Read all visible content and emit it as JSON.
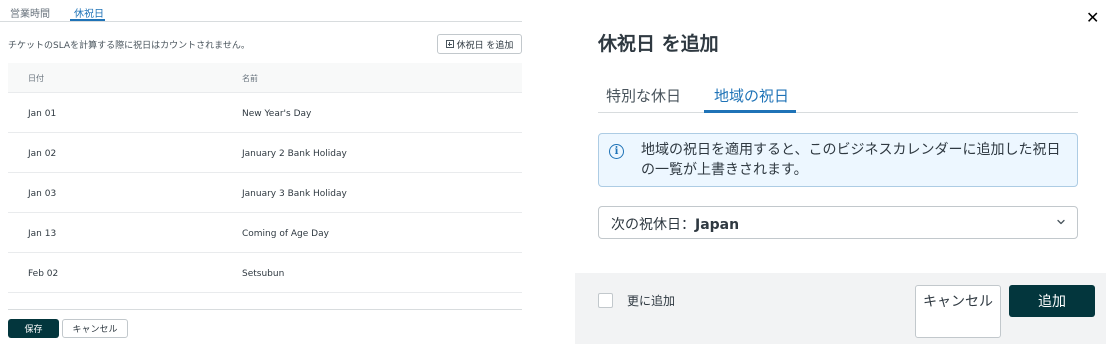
{
  "settings": {
    "tabs": [
      {
        "label": "営業時間"
      },
      {
        "label": "休祝日"
      }
    ],
    "note": "チケットのSLAを計算する際に祝日はカウントされません。",
    "add_holiday_label": "休祝日 を追加",
    "table": {
      "headers": {
        "date": "日付",
        "name": "名前"
      },
      "rows": [
        {
          "date": "Jan 01",
          "name": "New Year's Day"
        },
        {
          "date": "Jan 02",
          "name": "January 2 Bank Holiday"
        },
        {
          "date": "Jan 03",
          "name": "January 3 Bank Holiday"
        },
        {
          "date": "Jan 13",
          "name": "Coming of Age Day"
        },
        {
          "date": "Feb 02",
          "name": "Setsubun"
        }
      ]
    },
    "save_label": "保存",
    "cancel_label": "キャンセル"
  },
  "modal": {
    "close_glyph": "✕",
    "title": "休祝日 を追加",
    "tabs": [
      {
        "label": "特別な休日"
      },
      {
        "label": "地域の祝日"
      }
    ],
    "info_icon_glyph": "i",
    "info_text": "地域の祝日を適用すると、このビジネスカレンダーに追加した祝日の一覧が上書きされます。",
    "select": {
      "prefix": "次の祝休日：",
      "value": "Japan"
    },
    "checkbox_label": "更に追加",
    "cancel_label": "キャンセル",
    "add_label": "追加"
  },
  "colors": {
    "primary_dark": "#03363d",
    "accent_blue": "#1f73b7",
    "info_bg": "#edf7ff"
  }
}
